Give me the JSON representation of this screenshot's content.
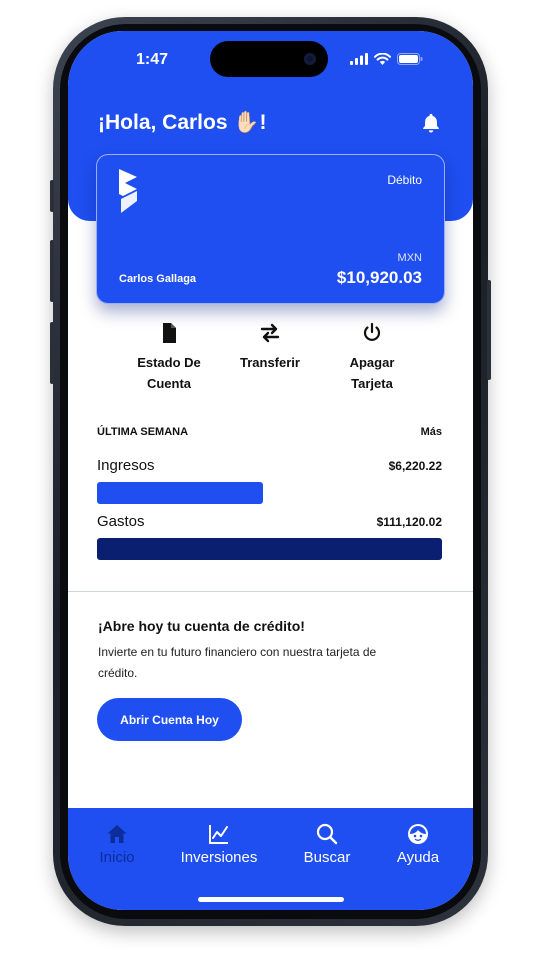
{
  "status_bar": {
    "time": "1:47"
  },
  "header": {
    "greeting": "¡Hola, Carlos ✋🏻!"
  },
  "card": {
    "type": "Débito",
    "currency": "MXN",
    "holder": "Carlos Gallaga",
    "balance": "$10,920.03"
  },
  "actions": [
    {
      "label_line1": "Estado De",
      "label_line2": "Cuenta",
      "icon": "document-icon"
    },
    {
      "label_line1": "Transferir",
      "label_line2": "",
      "icon": "transfer-arrows-icon"
    },
    {
      "label_line1": "Apagar",
      "label_line2": "Tarjeta",
      "icon": "power-icon"
    }
  ],
  "summary": {
    "title": "ÚLTIMA SEMANA",
    "more": "Más",
    "rows": [
      {
        "label": "Ingresos",
        "value": "$6,220.22",
        "fill": 0.48,
        "color": "#1f4ff0"
      },
      {
        "label": "Gastos",
        "value": "$111,120.02",
        "fill": 1.0,
        "color": "#0a1f70"
      }
    ]
  },
  "promo": {
    "title": "¡Abre hoy tu cuenta de crédito!",
    "description": "Invierte en tu futuro financiero con nuestra tarjeta de crédito.",
    "button": "Abrir Cuenta Hoy"
  },
  "nav": [
    {
      "label": "Inicio",
      "icon": "home-icon",
      "active": true
    },
    {
      "label": "Inversiones",
      "icon": "chart-line-icon",
      "active": false
    },
    {
      "label": "Buscar",
      "icon": "search-icon",
      "active": false
    },
    {
      "label": "Ayuda",
      "icon": "support-agent-icon",
      "active": false
    }
  ],
  "colors": {
    "primary": "#1f4ff0",
    "dark": "#0a1f70",
    "active_nav": "#0c2d9a"
  }
}
